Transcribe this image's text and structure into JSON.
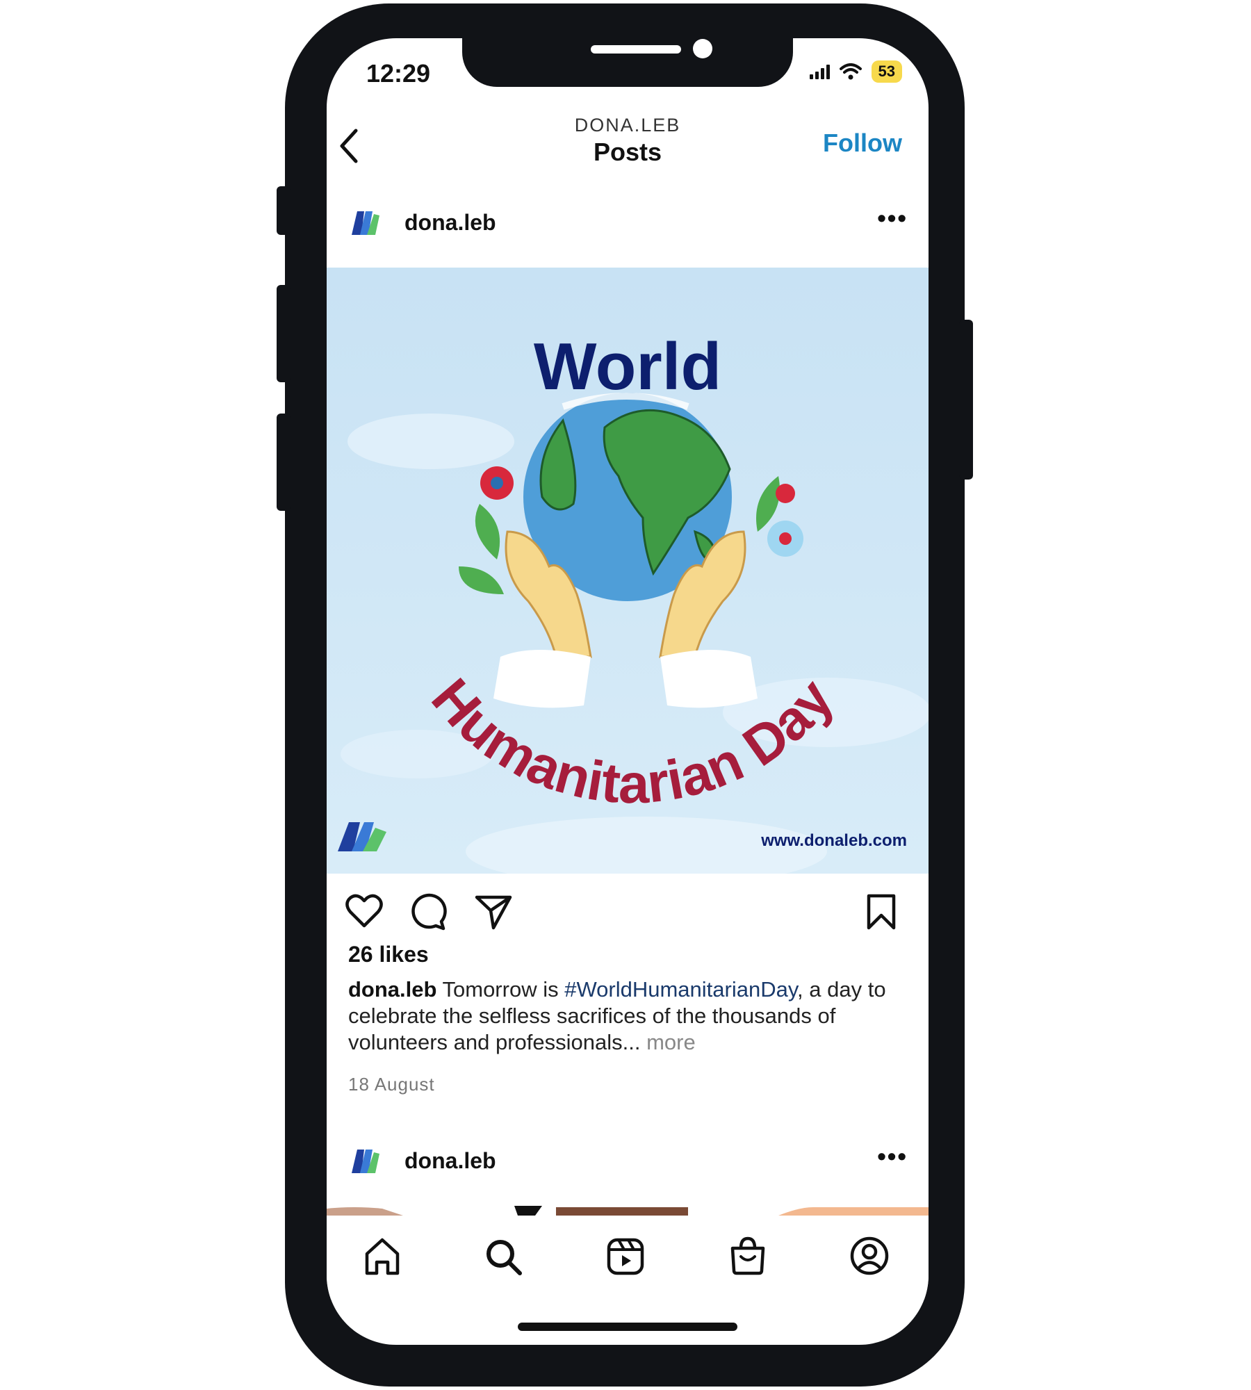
{
  "status_bar": {
    "time": "12:29",
    "battery": "53",
    "icons": [
      "signal-icon",
      "wifi-icon",
      "battery-icon"
    ]
  },
  "header": {
    "username": "DONA.LEB",
    "title": "Posts",
    "follow_label": "Follow",
    "back_icon": "chevron-left-icon"
  },
  "post": {
    "username": "dona.leb",
    "image": {
      "title_top": "World",
      "title_arc": "Humanitarian Day",
      "website": "www.donaleb.com"
    },
    "actions": [
      "heart-icon",
      "comment-icon",
      "share-icon",
      "bookmark-icon"
    ],
    "likes": "26 likes",
    "caption": {
      "username": "dona.leb",
      "text_before_tag": " Tomorrow is ",
      "hashtag": "#WorldHumanitarianDay",
      "text_after_tag": ", a day to celebrate the selfless sacrifices of the thousands of volunteers and professionals...",
      "more": " more"
    },
    "date": "18 August"
  },
  "next_post": {
    "username": "dona.leb"
  },
  "tab_bar": [
    "home-icon",
    "search-icon",
    "reels-icon",
    "shop-icon",
    "profile-icon"
  ],
  "colors": {
    "accent": "#1c86c4",
    "globe_land": "#3f9b45",
    "arc_text": "#a61d3c",
    "world_text": "#0d1f6e",
    "image_bg": "#cfe6f6"
  }
}
